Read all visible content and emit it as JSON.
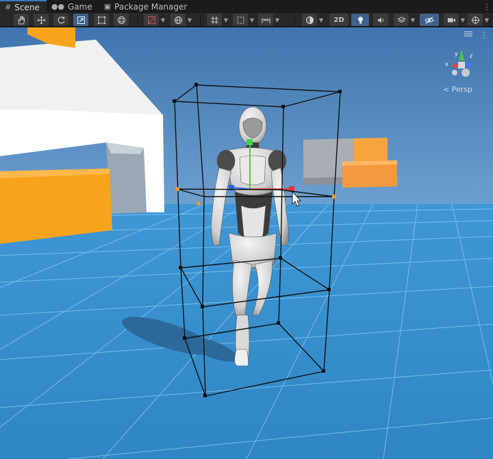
{
  "tabs": [
    {
      "label": "Scene",
      "icon": "scene-grid-icon",
      "active": true
    },
    {
      "label": "Game",
      "icon": "gamepad-icon",
      "active": false
    },
    {
      "label": "Package Manager",
      "icon": "package-icon",
      "active": false
    }
  ],
  "tab_menu_glyph": "⋮",
  "toolbar": {
    "tools": [
      "hand-tool-icon",
      "move-tool-icon",
      "rotate-tool-icon",
      "scale-tool-icon",
      "rect-tool-icon",
      "transform-tool-icon"
    ],
    "selected_tool": "scale-tool-icon",
    "toggle_2d_label": "2D"
  },
  "scene_view": {
    "projection_label": "< Persp",
    "gizmo_axes": [
      "y",
      "x",
      "z"
    ],
    "colors": {
      "sky": "#4c7fb7",
      "ground": "#3a8fcf",
      "wall": "#ffffff",
      "accent_block": "#f7a41c",
      "grid_line": "#7fc6f0",
      "selection_box": "#111111"
    }
  }
}
